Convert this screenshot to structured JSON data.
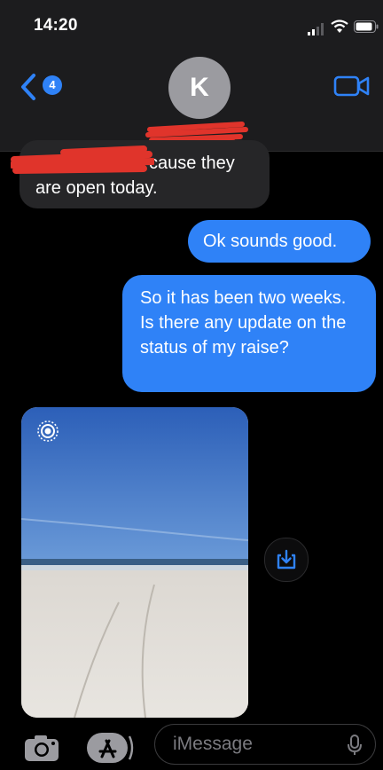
{
  "status_bar": {
    "time": "14:20"
  },
  "header": {
    "back_badge": "4",
    "avatar_initial": "K"
  },
  "messages": [
    {
      "direction": "received",
      "text": "cause they are open today."
    },
    {
      "direction": "sent",
      "text": "Ok sounds good."
    },
    {
      "direction": "sent",
      "text": "So it has been two weeks. Is there any update on the status of my raise?"
    },
    {
      "direction": "received",
      "type": "photo",
      "description_icon": "live-photo-icon"
    }
  ],
  "composer": {
    "placeholder": "iMessage"
  },
  "colors": {
    "sent_bubble": "#2f82f7",
    "received_bubble": "#262628",
    "accent": "#2f82f7",
    "redaction": "#e0342b"
  },
  "icons": [
    "back-chevron-icon",
    "video-call-icon",
    "live-photo-icon",
    "save-photo-icon",
    "camera-icon",
    "app-store-icon",
    "microphone-icon"
  ]
}
